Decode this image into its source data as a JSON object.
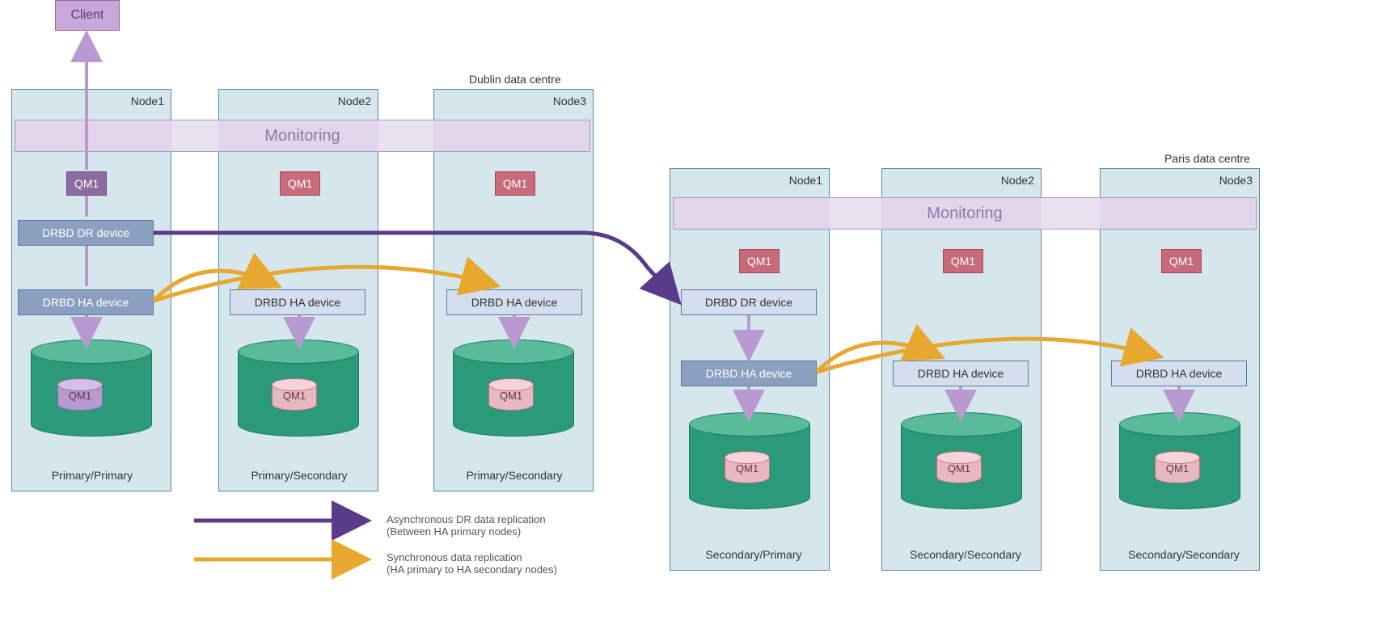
{
  "client": "Client",
  "dublin": {
    "label": "Dublin data centre",
    "monitoring": "Monitoring",
    "nodes": [
      {
        "name": "Node1",
        "qm": "QM1",
        "dr_device": "DRBD DR device",
        "ha_device": "DRBD HA device",
        "disk_qm": "QM1",
        "role": "Primary/Primary"
      },
      {
        "name": "Node2",
        "qm": "QM1",
        "ha_device": "DRBD HA device",
        "disk_qm": "QM1",
        "role": "Primary/Secondary"
      },
      {
        "name": "Node3",
        "qm": "QM1",
        "ha_device": "DRBD HA device",
        "disk_qm": "QM1",
        "role": "Primary/Secondary"
      }
    ]
  },
  "paris": {
    "label": "Paris data centre",
    "monitoring": "Monitoring",
    "nodes": [
      {
        "name": "Node1",
        "qm": "QM1",
        "dr_device": "DRBD DR device",
        "ha_device": "DRBD HA device",
        "disk_qm": "QM1",
        "role": "Secondary/Primary"
      },
      {
        "name": "Node2",
        "qm": "QM1",
        "ha_device": "DRBD HA device",
        "disk_qm": "QM1",
        "role": "Secondary/Secondary"
      },
      {
        "name": "Node3",
        "qm": "QM1",
        "ha_device": "DRBD HA device",
        "disk_qm": "QM1",
        "role": "Secondary/Secondary"
      }
    ]
  },
  "legend": {
    "async_line1": "Asynchronous DR data replication",
    "async_line2": "(Between HA primary nodes)",
    "sync_line1": "Synchronous data replication",
    "sync_line2": "(HA primary to HA secondary nodes)"
  }
}
